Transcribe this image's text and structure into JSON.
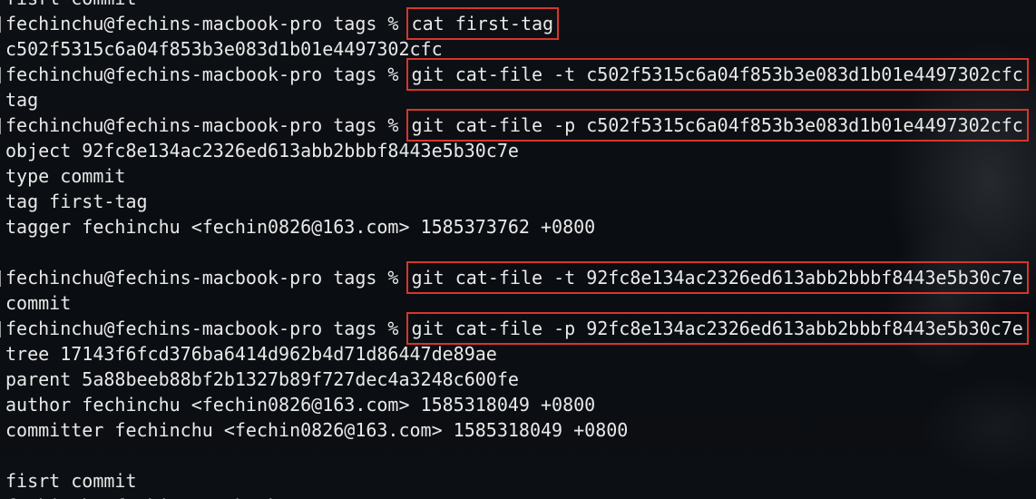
{
  "terminal": {
    "prompt": "fechinchu@fechins-macbook-pro tags % ",
    "lines": [
      {
        "type": "output",
        "text": "fisrt commit"
      },
      {
        "type": "prompt",
        "cmd": "cat first-tag",
        "boxed": true
      },
      {
        "type": "output",
        "text": "c502f5315c6a04f853b3e083d1b01e4497302cfc"
      },
      {
        "type": "prompt",
        "cmd": "git cat-file -t c502f5315c6a04f853b3e083d1b01e4497302cfc",
        "boxed": true
      },
      {
        "type": "output",
        "text": "tag"
      },
      {
        "type": "prompt",
        "cmd": "git cat-file -p c502f5315c6a04f853b3e083d1b01e4497302cfc",
        "boxed": true
      },
      {
        "type": "output",
        "text": "object 92fc8e134ac2326ed613abb2bbbf8443e5b30c7e"
      },
      {
        "type": "output",
        "text": "type commit"
      },
      {
        "type": "output",
        "text": "tag first-tag"
      },
      {
        "type": "output",
        "text": "tagger fechinchu <fechin0826@163.com> 1585373762 +0800"
      },
      {
        "type": "output",
        "text": ""
      },
      {
        "type": "prompt",
        "cmd": "git cat-file -t 92fc8e134ac2326ed613abb2bbbf8443e5b30c7e",
        "boxed": true
      },
      {
        "type": "output",
        "text": "commit"
      },
      {
        "type": "prompt",
        "cmd": "git cat-file -p 92fc8e134ac2326ed613abb2bbbf8443e5b30c7e",
        "boxed": true
      },
      {
        "type": "output",
        "text": "tree 17143f6fcd376ba6414d962b4d71d86447de89ae"
      },
      {
        "type": "output",
        "text": "parent 5a88beeb88bf2b1327b89f727dec4a3248c600fe"
      },
      {
        "type": "output",
        "text": "author fechinchu <fechin0826@163.com> 1585318049 +0800"
      },
      {
        "type": "output",
        "text": "committer fechinchu <fechin0826@163.com> 1585318049 +0800"
      },
      {
        "type": "output",
        "text": ""
      },
      {
        "type": "output",
        "text": "fisrt commit"
      },
      {
        "type": "prompt",
        "cmd": "",
        "boxed": false,
        "cursor": true
      }
    ]
  },
  "colors": {
    "highlight": "#d8352c",
    "text": "#e9e9e9",
    "cursor": "#8d8d8d"
  }
}
